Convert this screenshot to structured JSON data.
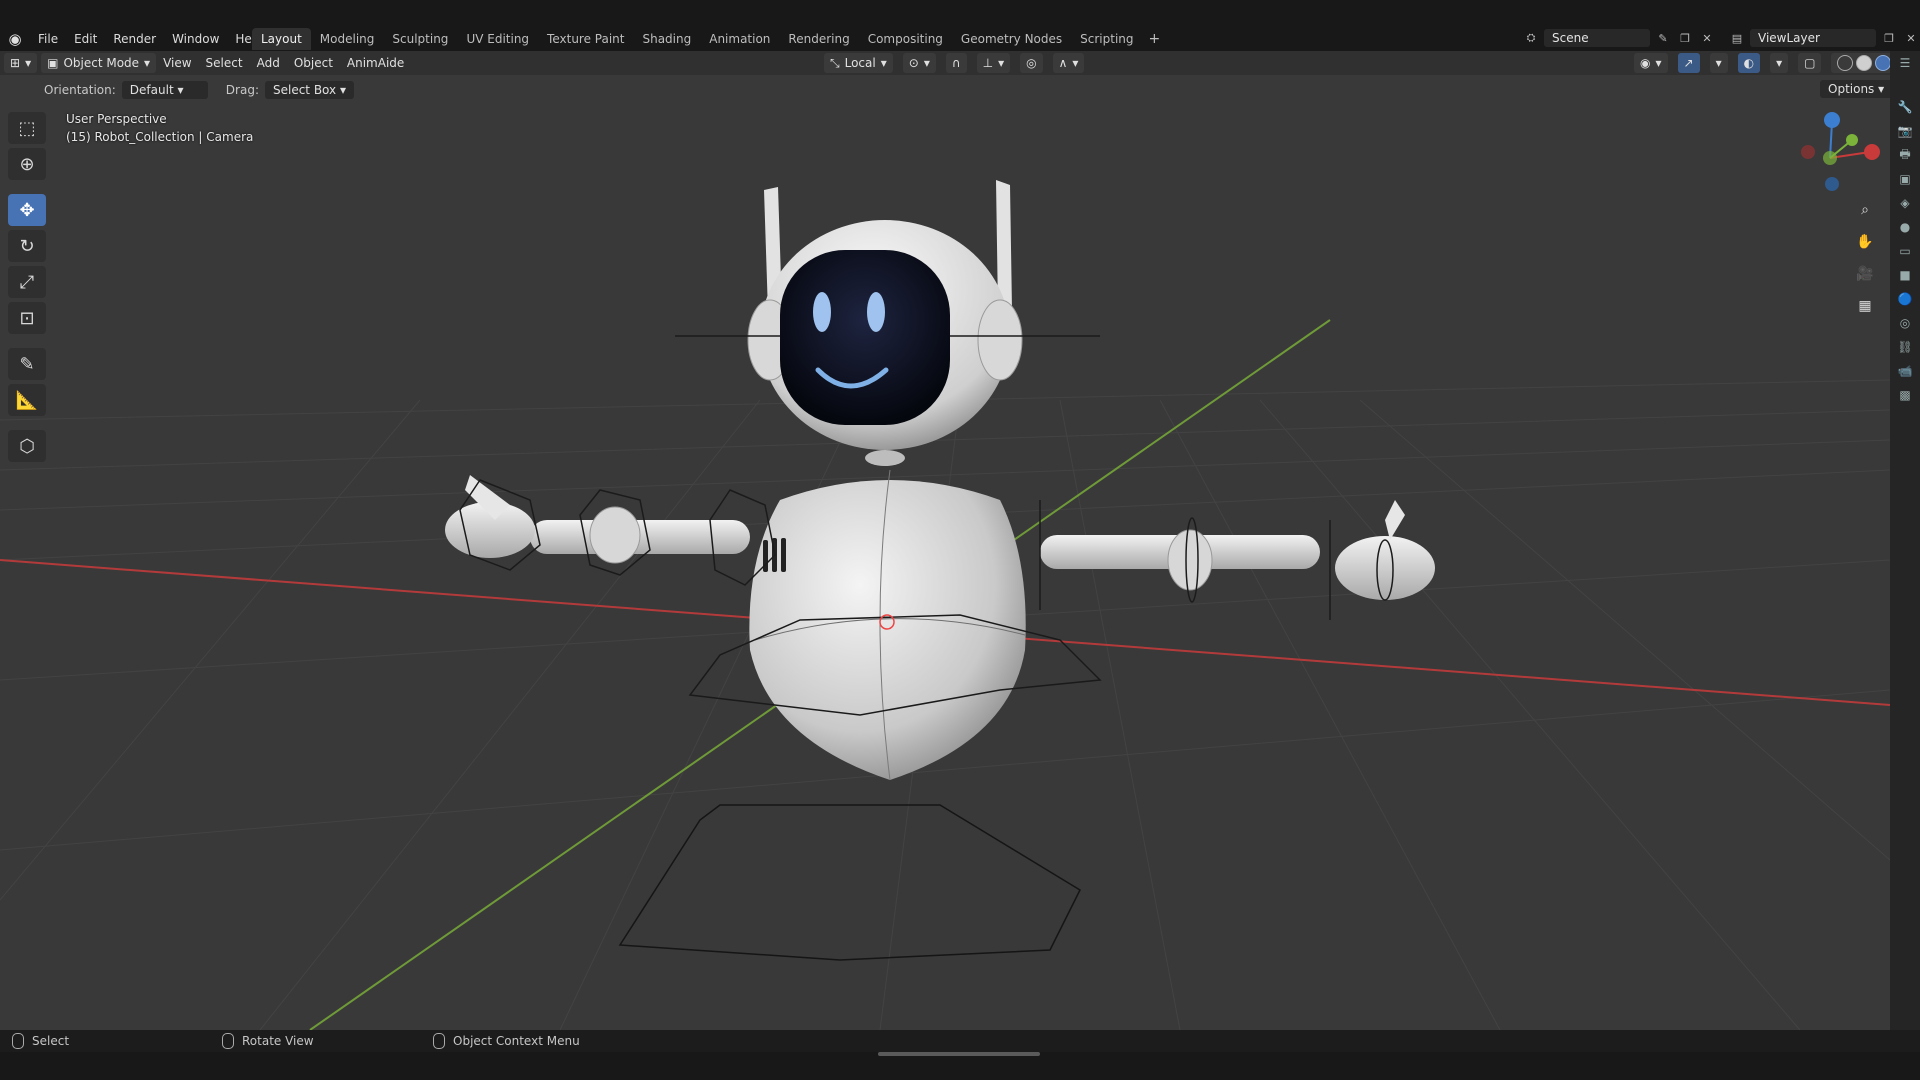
{
  "top_menu": {
    "items": [
      "File",
      "Edit",
      "Render",
      "Window",
      "Help"
    ]
  },
  "workspaces": {
    "tabs": [
      "Layout",
      "Modeling",
      "Sculpting",
      "UV Editing",
      "Texture Paint",
      "Shading",
      "Animation",
      "Rendering",
      "Compositing",
      "Geometry Nodes",
      "Scripting"
    ],
    "active": "Layout",
    "add_label": "+"
  },
  "scene": {
    "name": "Scene",
    "view_layer": "ViewLayer"
  },
  "header": {
    "mode": "Object Mode",
    "menus": [
      "View",
      "Select",
      "Add",
      "Object",
      "AnimAide"
    ],
    "transform_orientation": "Local"
  },
  "tool_settings": {
    "orientation_label": "Orientation:",
    "orientation_value": "Default",
    "drag_label": "Drag:",
    "drag_value": "Select Box",
    "options_label": "Options"
  },
  "viewport": {
    "perspective": "User Perspective",
    "active_object": "(15) Robot_Collection | Camera"
  },
  "toolbar_tools": [
    "select-box",
    "cursor",
    "move",
    "rotate",
    "scale",
    "transform",
    "annotate",
    "measure",
    "add-cube"
  ],
  "active_tool": "move",
  "status": {
    "left": "Select",
    "middle": "Rotate View",
    "right": "Object Context Menu"
  },
  "colors": {
    "accent": "#4772b3",
    "x_axis": "#c93a3a",
    "y_axis": "#7bb33a",
    "z_axis": "#3c7fd0"
  }
}
